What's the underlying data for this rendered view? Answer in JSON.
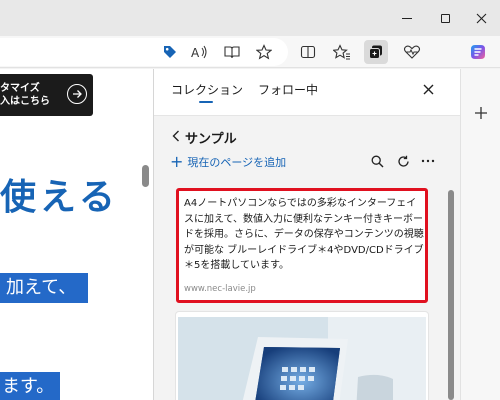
{
  "promo": {
    "line1": "タマイズ",
    "line2": "入はこちら"
  },
  "page": {
    "title": "使える",
    "highlight1": "加えて、",
    "highlight2": "ます。"
  },
  "collections": {
    "tabs": [
      "コレクション",
      "フォロー中"
    ],
    "active_tab": "コレクション",
    "name": "サンプル",
    "add_current_page": "現在のページを追加",
    "accent_color": "#1764b5",
    "items": [
      {
        "type": "text",
        "text": "A4ノートパソコンならではの多彩なインターフェイスに加えて、数値入力に便利なテンキー付きキーボードを採用。さらに、データの保存やコンテンツの視聴が可能な ブルーレイドライブ＊4やDVD/CDドライブ＊5を搭載しています。",
        "source": "www.nec-lavie.jp",
        "highlight_color": "#e0101f"
      },
      {
        "type": "image",
        "alt": "laptop-image"
      }
    ]
  },
  "icons": {
    "toolbar": [
      "tag-icon",
      "read-aloud-icon",
      "immersive-reader-icon",
      "favorite-star-icon",
      "split-screen-icon",
      "favorites-icon",
      "collections-icon",
      "performance-heart-icon",
      "copilot-icon"
    ],
    "panel": [
      "close-icon",
      "back-chevron-icon",
      "add-plus-icon",
      "search-icon",
      "refresh-icon",
      "more-icon"
    ]
  }
}
